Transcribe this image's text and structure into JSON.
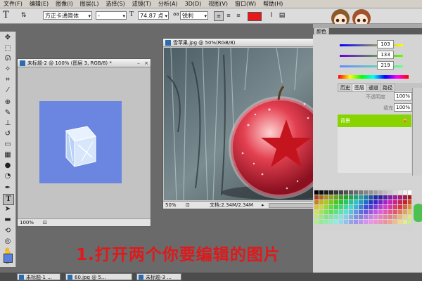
{
  "menu": [
    "文件(F)",
    "编辑(E)",
    "图像(I)",
    "图层(L)",
    "选择(S)",
    "滤镜(T)",
    "分析(A)",
    "3D(D)",
    "视图(V)",
    "窗口(W)",
    "帮助(H)"
  ],
  "options": {
    "tool_icon": "text-tool-icon",
    "font_family": "方正卡通简体",
    "font_style": "-",
    "font_size": "74.87 点",
    "antialias": "锐利",
    "text_color": "#e8171c"
  },
  "windows": {
    "small": {
      "title": "未标题-2 @ 100% (图层 3, RGB/8) *",
      "zoom": "100%"
    },
    "apple": {
      "title": "雪苹果.jpg @ 50%(RGB/8)",
      "zoom": "50%",
      "doc_info": "文档:2.34M/2.34M"
    }
  },
  "panels": {
    "color_tab": "颜色",
    "values": [
      "103",
      "133",
      "219"
    ],
    "layers_tabs": [
      "历史",
      "图层",
      "通道",
      "路径"
    ],
    "opacity_label": "不透明度",
    "opacity": "100%",
    "fill_label": "填充",
    "fill": "100%",
    "layer_name": "背景"
  },
  "caption": "1.打开两个你要编辑的图片",
  "taskbar": [
    "未标题-1 ...",
    "60.jpg @ 5...",
    "未标题-3 ..."
  ],
  "colors": {
    "bg_panel": "#6a6a6a",
    "layer_selected": "#88d400",
    "canvas_blue": "#6a86e0"
  }
}
